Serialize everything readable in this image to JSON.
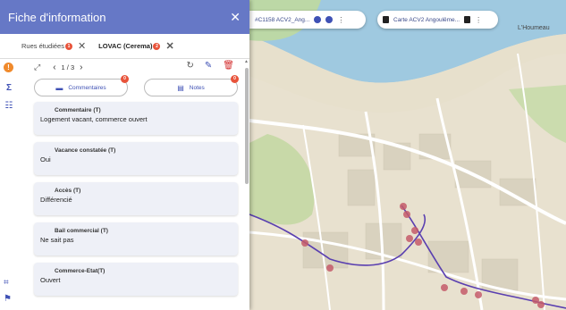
{
  "panel": {
    "title": "Fiche d'information",
    "close_icon": "close-icon",
    "tabs": [
      {
        "label": "Rues étudiées",
        "badge": "1",
        "active": false
      },
      {
        "label": "LOVAC (Cerema)",
        "badge": "2",
        "active": true
      }
    ],
    "pager": "1 / 3",
    "actions": [
      {
        "label": "Commentaires",
        "badge": "0",
        "icon": "comment-icon"
      },
      {
        "label": "Notes",
        "badge": "0",
        "icon": "notes-icon"
      }
    ],
    "cards": [
      {
        "label": "Commentaire (T)",
        "value": "Logement vacant, commerce ouvert"
      },
      {
        "label": "Vacance constatée (T)",
        "value": "Oui"
      },
      {
        "label": "Accès (T)",
        "value": "Différencié"
      },
      {
        "label": "Bail commercial (T)",
        "value": "Ne sait pas"
      },
      {
        "label": "Commerce-Etat(T)",
        "value": "Ouvert"
      }
    ]
  },
  "map": {
    "chip1": {
      "text": "#C1158 ACV2_Ang..."
    },
    "chip2": {
      "text": "Carte ACV2 Angoulême..."
    },
    "place_label": "L'Houmeau",
    "accent_color": "#3f51b5",
    "marker_color": "#c45a6a"
  }
}
